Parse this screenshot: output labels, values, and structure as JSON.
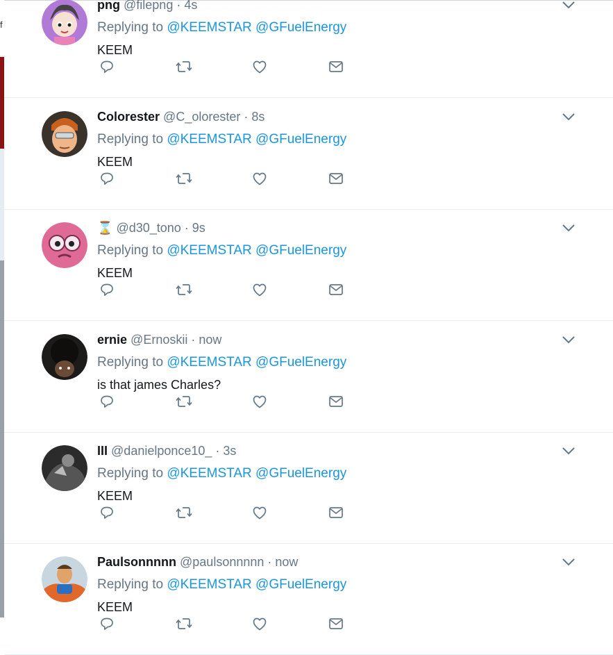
{
  "reply_prefix": "Replying to",
  "tweets": [
    {
      "name": "png",
      "handle": "@filepng",
      "time": "4s",
      "mentions": [
        "@KEEMSTAR",
        "@GFuelEnergy"
      ],
      "text": "KEEM",
      "avatar_icon": "anime-avatar-icon",
      "avatar_color": "#b07ad6"
    },
    {
      "name": "Colorester",
      "handle": "@C_olorester",
      "time": "8s",
      "mentions": [
        "@KEEMSTAR",
        "@GFuelEnergy"
      ],
      "text": "KEEM",
      "avatar_icon": "cartoon-face-avatar-icon",
      "avatar_color": "#2f2a25"
    },
    {
      "name": "⌛",
      "handle": "@d30_tono",
      "time": "9s",
      "mentions": [
        "@KEEMSTAR",
        "@GFuelEnergy"
      ],
      "text": "KEEM",
      "avatar_icon": "pink-character-avatar-icon",
      "avatar_color": "#d85a8c"
    },
    {
      "name": "ernie",
      "handle": "@Ernoskii",
      "time": "now",
      "mentions": [
        "@KEEMSTAR",
        "@GFuelEnergy"
      ],
      "text": "is that james Charles?",
      "avatar_icon": "photo-face-avatar-icon",
      "avatar_color": "#1d1b1a"
    },
    {
      "name": "III",
      "handle": "@danielponce10_",
      "time": "3s",
      "mentions": [
        "@KEEMSTAR",
        "@GFuelEnergy"
      ],
      "text": "KEEM",
      "avatar_icon": "bw-photo-avatar-icon",
      "avatar_color": "#3a3a3a"
    },
    {
      "name": "Paulsonnnnn",
      "handle": "@paulsonnnnn",
      "time": "now",
      "mentions": [
        "@KEEMSTAR",
        "@GFuelEnergy"
      ],
      "text": "KEEM",
      "avatar_icon": "cartoon-fire-avatar-icon",
      "avatar_color": "#d8642a"
    }
  ],
  "colors": {
    "link": "#1b95e0",
    "secondary_text": "#657786",
    "primary_text": "#14171a",
    "divider": "#e6ecf0"
  },
  "backdrop_glyph": "f"
}
